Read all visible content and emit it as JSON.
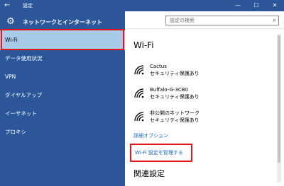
{
  "window": {
    "title": "設定",
    "back_glyph": "←",
    "minimize_glyph": "—",
    "maximize_glyph": "☐",
    "close_glyph": "✕"
  },
  "sidebar": {
    "section_title": "ネットワークとインターネット",
    "items": [
      {
        "label": "Wi-Fi",
        "selected": true
      },
      {
        "label": "データ使用状況",
        "selected": false
      },
      {
        "label": "VPN",
        "selected": false
      },
      {
        "label": "ダイヤルアップ",
        "selected": false
      },
      {
        "label": "イーサネット",
        "selected": false
      },
      {
        "label": "プロキシ",
        "selected": false
      }
    ]
  },
  "search": {
    "placeholder": "設定の検索",
    "icon": "search-icon"
  },
  "main": {
    "heading": "Wi-Fi",
    "networks": [
      {
        "name": "Cactus",
        "status": "セキュリティ保護あり"
      },
      {
        "name": "Buffalo-G-3CB0",
        "status": "セキュリティ保護あり"
      },
      {
        "name": "非公開のネットワーク",
        "status": "セキュリティ保護あり"
      }
    ],
    "advanced_link": "詳細オプション",
    "manage_link": "Wi-Fi 設定を管理する",
    "related_heading": "関連設定"
  },
  "colors": {
    "accent": "#2b579a",
    "selected_bg": "#a7cbe8",
    "highlight_border": "#e6151c",
    "link": "#1565c0"
  }
}
